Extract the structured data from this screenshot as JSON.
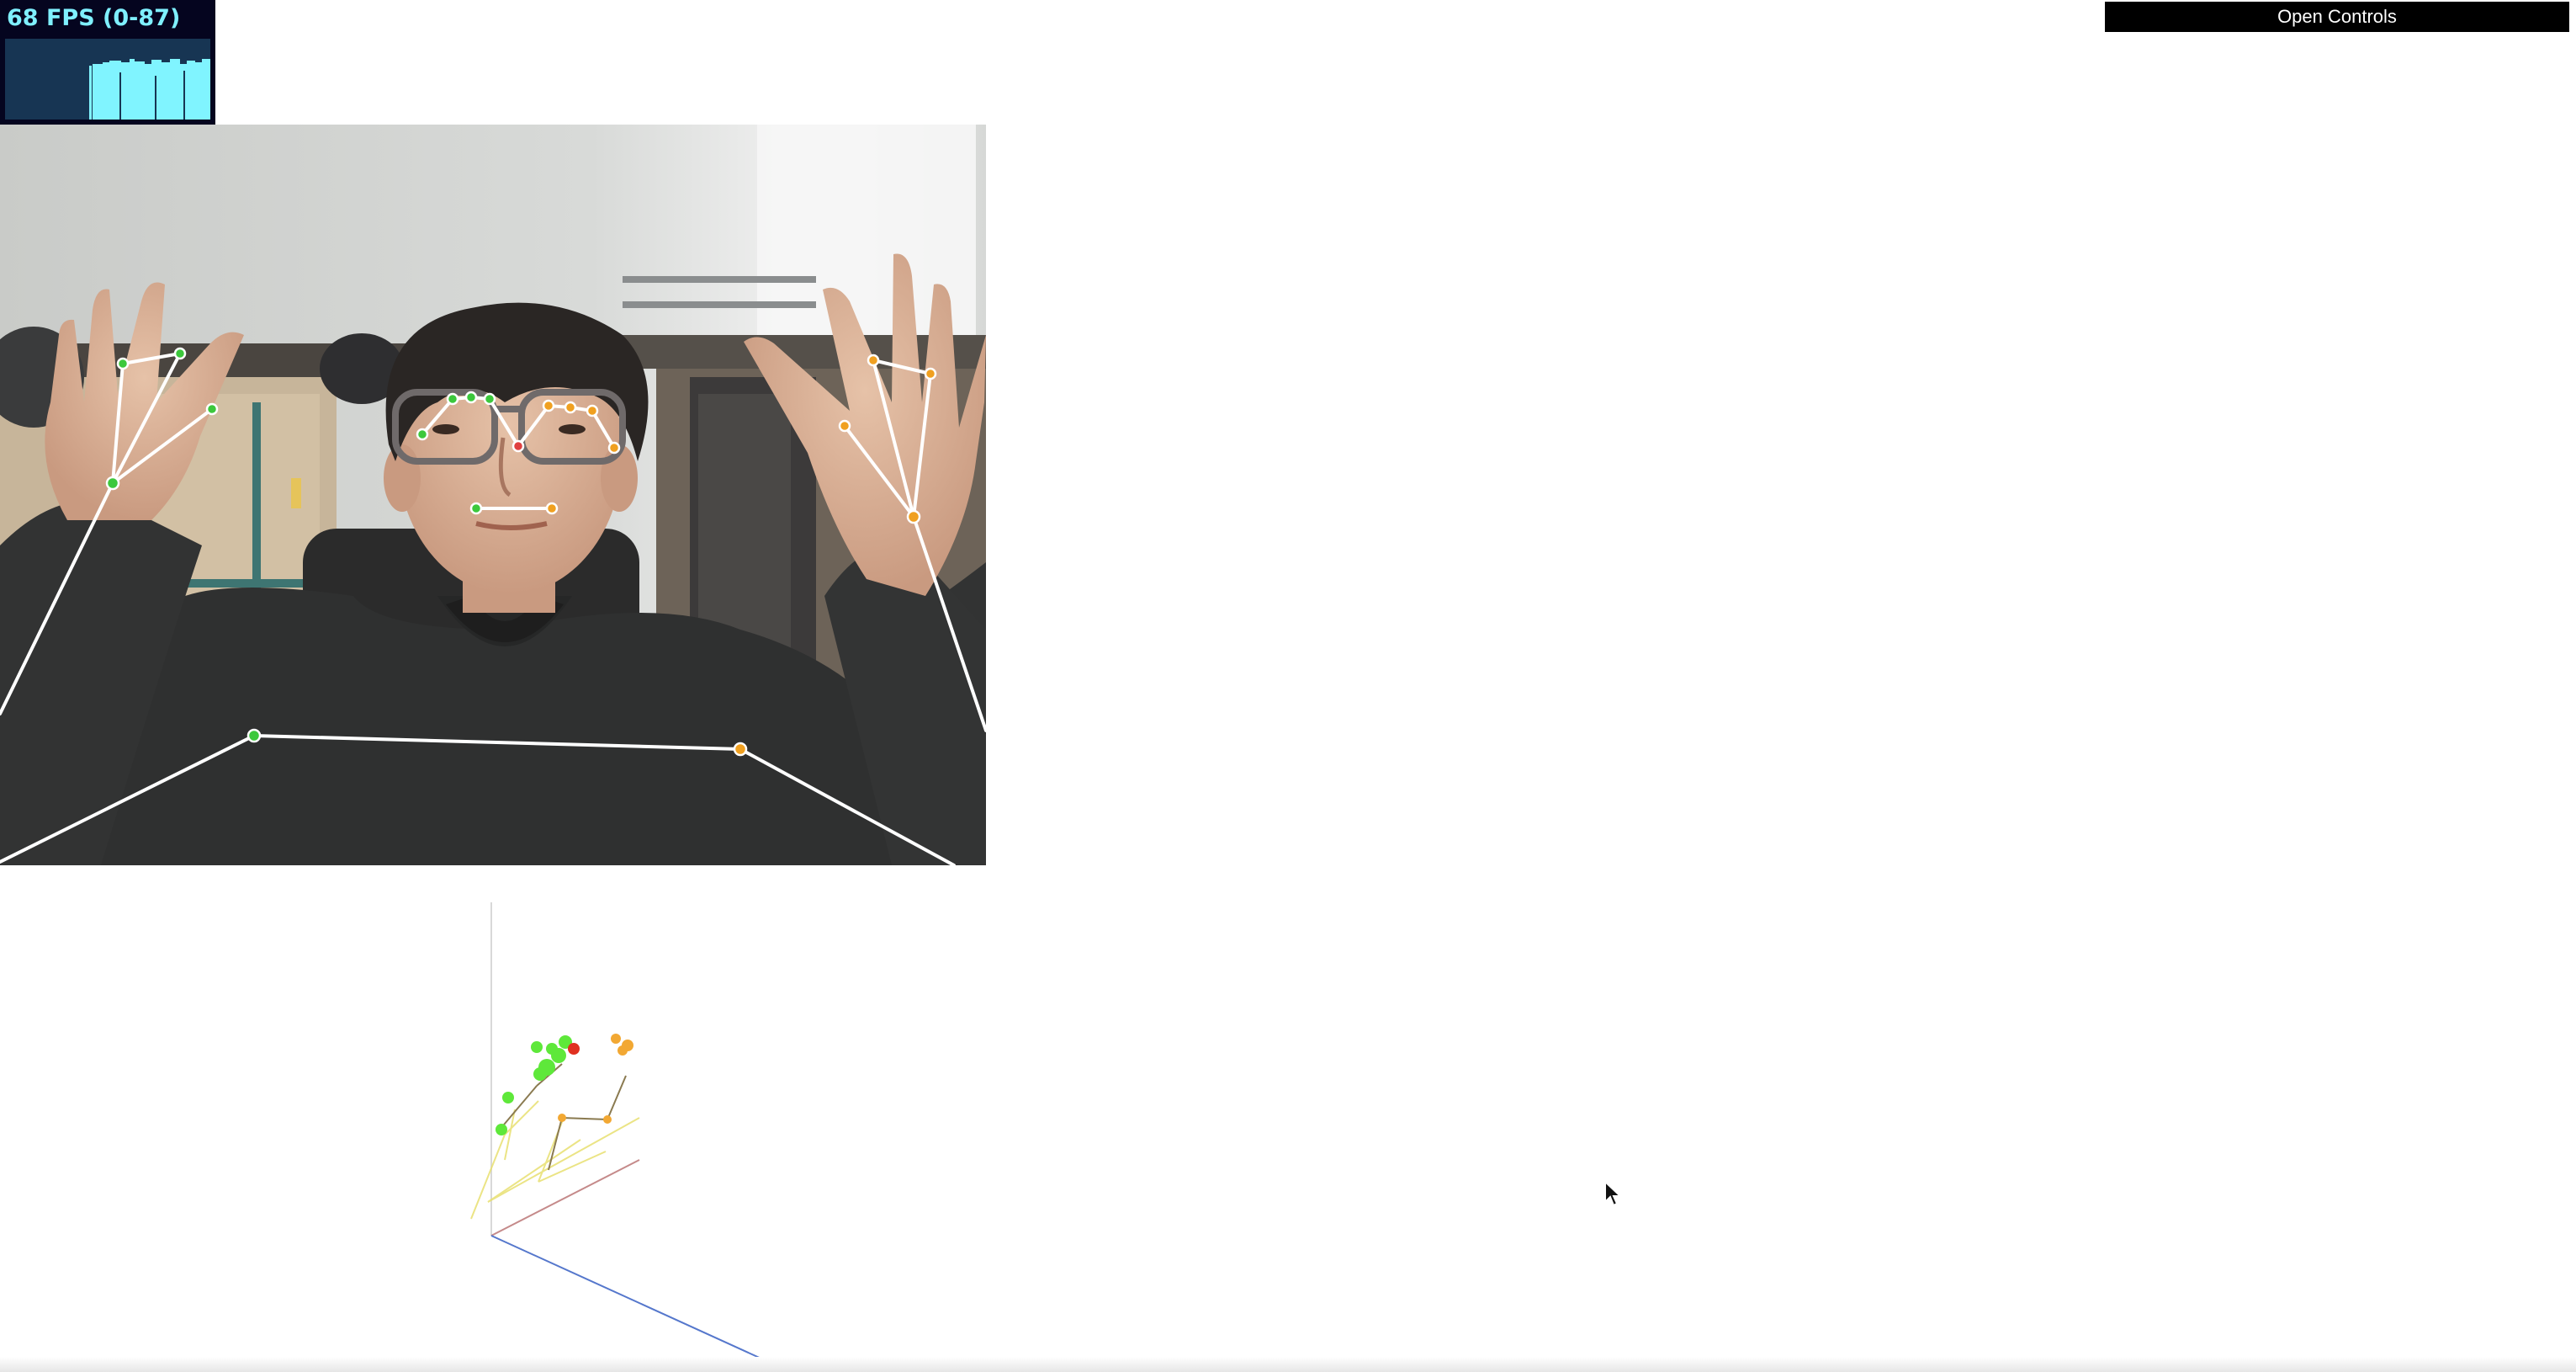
{
  "stats": {
    "fps_label": "68 FPS (0-87)",
    "fps_current": 68,
    "fps_min": 0,
    "fps_max": 87,
    "colors": {
      "background": "#05051f",
      "text": "#7ff0ff",
      "graph_bg": "#173553",
      "graph_bar": "#80f4ff"
    }
  },
  "controls": {
    "open_label": "Open Controls"
  },
  "pose_overlay": {
    "colors": {
      "left_side": "#3cc83c",
      "right_side": "#f0a020",
      "nose": "#e04040",
      "bones": "#ffffff"
    }
  },
  "scene": {
    "axis_colors": {
      "x": "#c07070",
      "y": "#d0d0d0",
      "z": "#5070d0"
    },
    "point_colors": {
      "left_side": "#5ee83a",
      "right_side": "#f2a833",
      "nose": "#e03020",
      "bones": "#e8e070"
    }
  }
}
